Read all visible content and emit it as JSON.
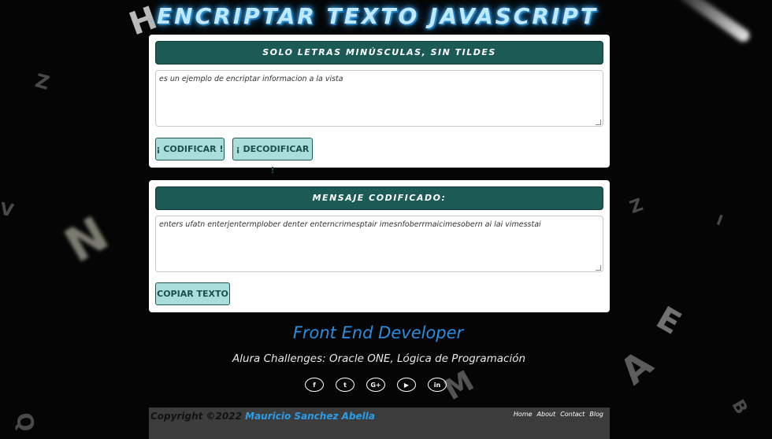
{
  "header": {
    "title": "ENCRIPTAR TEXTO JAVASCRIPT"
  },
  "encrypt_section": {
    "heading": "SOLO LETRAS MINÚSCULAS, SIN TILDES",
    "input_text": "es un ejemplo de encriptar informacion a la vista",
    "encrypt_button": "¡ CODIFICAR !",
    "decrypt_button": "¡ DECODIFICAR !"
  },
  "output_section": {
    "heading": "MENSAJE CODIFICADO:",
    "output_text": "enters ufatn enterjentermplober denter enterncrimesptair imesnfoberrmaicimesobern ai lai vimesstai",
    "copy_button": "COPIAR TEXTO"
  },
  "profile": {
    "role": "Front End Developer",
    "subtitle": "Alura Challenges: Oracle ONE, Lógica de Programación"
  },
  "socials": [
    {
      "icon": "facebook-icon",
      "glyph": "f"
    },
    {
      "icon": "twitter-icon",
      "glyph": "t"
    },
    {
      "icon": "google-plus-icon",
      "glyph": "G+"
    },
    {
      "icon": "youtube-icon",
      "glyph": "▶"
    },
    {
      "icon": "linkedin-icon",
      "glyph": "in"
    }
  ],
  "footer": {
    "copyright_prefix": "Copyright ©2022",
    "author": "Mauricio Sanchez Abella",
    "links": [
      "Home",
      "About",
      "Contact",
      "Blog"
    ]
  },
  "colors": {
    "header_bg": "#1c5a55",
    "button_bg": "#a9dedd",
    "accent_blue": "#2a8ee0",
    "page_bg": "#050505"
  }
}
